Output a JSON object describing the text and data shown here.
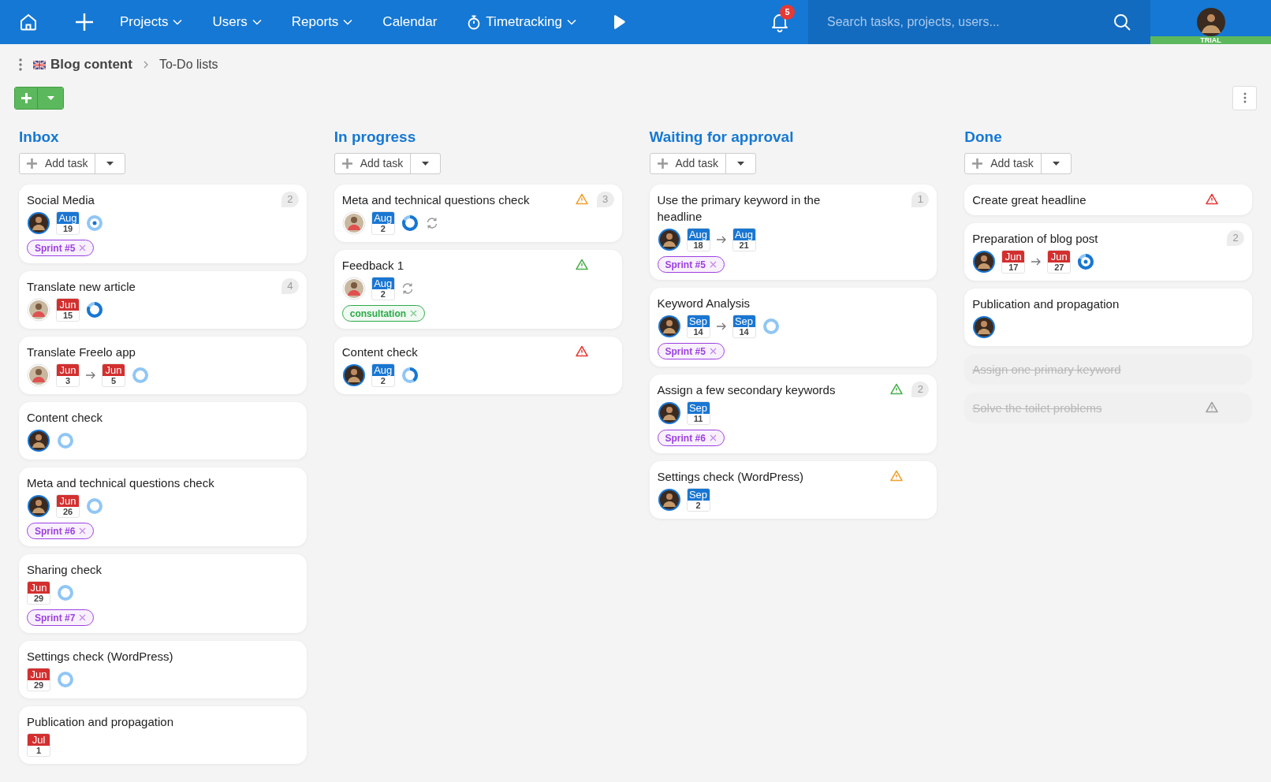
{
  "nav": {
    "items": [
      {
        "label": "Projects",
        "dropdown": true,
        "kind": "plain"
      },
      {
        "label": "Users",
        "dropdown": true,
        "kind": "plain"
      },
      {
        "label": "Reports",
        "dropdown": true,
        "kind": "plain"
      },
      {
        "label": "Calendar",
        "dropdown": false,
        "kind": "plain"
      },
      {
        "label": "Timetracking",
        "dropdown": true,
        "kind": "timer"
      }
    ]
  },
  "notifications": {
    "count": "5"
  },
  "search": {
    "placeholder": "Search tasks, projects, users..."
  },
  "user": {
    "badge": "TRIAL"
  },
  "breadcrumb": {
    "project": "Blog content",
    "page": "To-Do lists"
  },
  "columns": [
    {
      "title": "Inbox",
      "add_label": "Add task",
      "cards": [
        {
          "title": "Social Media",
          "count": "2",
          "avatar": {
            "ringed": true
          },
          "dates": [
            {
              "month": "Aug",
              "day": "19",
              "color": "#1976d2"
            }
          ],
          "progress": {
            "kind": "empty",
            "dot": true
          },
          "tags": [
            {
              "label": "Sprint #5",
              "color": "#9c3fe0"
            }
          ]
        },
        {
          "title": "Translate new article",
          "count": "4",
          "avatar": {
            "ringed": false
          },
          "dates": [
            {
              "month": "Jun",
              "day": "15",
              "color": "#d32f2f"
            }
          ],
          "progress": {
            "kind": "most",
            "dot": false
          }
        },
        {
          "title": "Translate Freelo app",
          "avatar": {
            "ringed": false
          },
          "dates": [
            {
              "month": "Jun",
              "day": "3",
              "color": "#d32f2f"
            },
            {
              "month": "Jun",
              "day": "5",
              "color": "#d32f2f"
            }
          ],
          "progress": {
            "kind": "empty",
            "dot": false
          }
        },
        {
          "title": "Content check",
          "avatar": {
            "ringed": true
          },
          "progress": {
            "kind": "empty",
            "dot": false
          }
        },
        {
          "title": "Meta and technical questions check",
          "avatar": {
            "ringed": true
          },
          "dates": [
            {
              "month": "Jun",
              "day": "26",
              "color": "#d32f2f"
            }
          ],
          "progress": {
            "kind": "empty",
            "dot": false
          },
          "tags": [
            {
              "label": "Sprint #6",
              "color": "#9c3fe0"
            }
          ]
        },
        {
          "title": "Sharing check",
          "dates": [
            {
              "month": "Jun",
              "day": "29",
              "color": "#d32f2f"
            }
          ],
          "progress": {
            "kind": "empty",
            "dot": false
          },
          "tags": [
            {
              "label": "Sprint #7",
              "color": "#9c3fe0"
            }
          ]
        },
        {
          "title": "Settings check (WordPress)",
          "dates": [
            {
              "month": "Jun",
              "day": "29",
              "color": "#d32f2f"
            }
          ],
          "progress": {
            "kind": "empty",
            "dot": false
          }
        },
        {
          "title": "Publication and propagation",
          "dates": [
            {
              "month": "Jul",
              "day": "1",
              "color": "#d32f2f"
            }
          ]
        }
      ]
    },
    {
      "title": "In progress",
      "add_label": "Add task",
      "cards": [
        {
          "title": "Meta and technical questions check",
          "count": "3",
          "warning": {
            "color": "#f0a030"
          },
          "avatar": {
            "ringed": false
          },
          "dates": [
            {
              "month": "Aug",
              "day": "2",
              "color": "#1976d2"
            }
          ],
          "progress": {
            "kind": "most",
            "dot": false
          },
          "recurring": true
        },
        {
          "title": "Feedback 1",
          "warning": {
            "color": "#4caf50"
          },
          "avatar": {
            "ringed": false
          },
          "dates": [
            {
              "month": "Aug",
              "day": "2",
              "color": "#1976d2"
            }
          ],
          "recurring": true,
          "tags": [
            {
              "label": "consultation",
              "color": "#2eaa4a"
            }
          ]
        },
        {
          "title": "Content check",
          "warning": {
            "color": "#e53935"
          },
          "avatar": {
            "ringed": true
          },
          "dates": [
            {
              "month": "Aug",
              "day": "2",
              "color": "#1976d2"
            }
          ],
          "progress": {
            "kind": "third",
            "dot": false
          }
        }
      ]
    },
    {
      "title": "Waiting for approval",
      "add_label": "Add task",
      "cards": [
        {
          "title": "Use the primary keyword in the headline",
          "count": "1",
          "avatar": {
            "ringed": true
          },
          "dates": [
            {
              "month": "Aug",
              "day": "18",
              "color": "#1976d2"
            },
            {
              "month": "Aug",
              "day": "21",
              "color": "#1976d2"
            }
          ],
          "tags": [
            {
              "label": "Sprint #5",
              "color": "#9c3fe0"
            }
          ]
        },
        {
          "title": "Keyword Analysis",
          "avatar": {
            "ringed": true
          },
          "dates": [
            {
              "month": "Sep",
              "day": "14",
              "color": "#1976d2"
            },
            {
              "month": "Sep",
              "day": "14",
              "color": "#1976d2"
            }
          ],
          "progress": {
            "kind": "empty",
            "dot": false
          },
          "tags": [
            {
              "label": "Sprint #5",
              "color": "#9c3fe0"
            }
          ]
        },
        {
          "title": "Assign a few secondary keywords",
          "count": "2",
          "warning": {
            "color": "#4caf50"
          },
          "avatar": {
            "ringed": true
          },
          "dates": [
            {
              "month": "Sep",
              "day": "11",
              "color": "#1976d2"
            }
          ],
          "tags": [
            {
              "label": "Sprint #6",
              "color": "#9c3fe0"
            }
          ]
        },
        {
          "title": "Settings check (WordPress)",
          "warning": {
            "color": "#f0a030"
          },
          "avatar": {
            "ringed": true
          },
          "dates": [
            {
              "month": "Sep",
              "day": "2",
              "color": "#1976d2"
            }
          ]
        }
      ]
    },
    {
      "title": "Done",
      "add_label": "Add task",
      "cards": [
        {
          "title": "Create great headline",
          "warning": {
            "color": "#e53935"
          }
        },
        {
          "title": "Preparation of blog post",
          "count": "2",
          "avatar": {
            "ringed": true
          },
          "dates": [
            {
              "month": "Jun",
              "day": "17",
              "color": "#d32f2f"
            },
            {
              "month": "Jun",
              "day": "27",
              "color": "#d32f2f"
            }
          ],
          "progress": {
            "kind": "most",
            "dot": true
          }
        },
        {
          "title": "Publication and propagation",
          "avatar": {
            "ringed": true
          }
        },
        {
          "title": "Assign one primary keyword",
          "done": true
        },
        {
          "title": "Solve the toilet problems",
          "done": true,
          "warning": {
            "color": "#9e9e9e"
          }
        }
      ]
    }
  ]
}
